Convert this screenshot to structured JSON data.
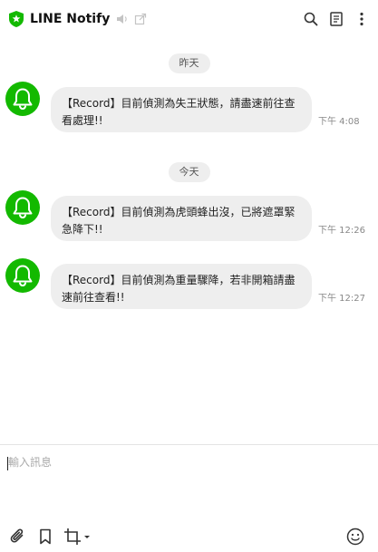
{
  "header": {
    "title": "LINE Notify",
    "icons": [
      "shield-star-icon",
      "mute-icon",
      "popout-icon",
      "search-icon",
      "notes-icon",
      "more-icon"
    ]
  },
  "colors": {
    "accent": "#13b900",
    "bubble": "#eeeeee",
    "date_chip": "#eeeeee"
  },
  "chat": {
    "dates": [
      "昨天",
      "今天"
    ],
    "messages": [
      {
        "text": "【Record】目前偵測為失王狀態，請盡速前往查看處理!!",
        "time": "下午 4:08"
      },
      {
        "text": "【Record】目前偵測為虎頭蜂出沒，已將遮罩緊急降下!!",
        "time": "下午 12:26"
      },
      {
        "text": "【Record】目前偵測為重量驟降，若非開箱請盡速前往查看!!",
        "time": "下午 12:27"
      }
    ]
  },
  "composer": {
    "placeholder": "輸入訊息",
    "value": ""
  },
  "toolbar": {
    "icons": [
      "attach-icon",
      "bookmark-icon",
      "crop-icon",
      "emoji-icon"
    ]
  }
}
